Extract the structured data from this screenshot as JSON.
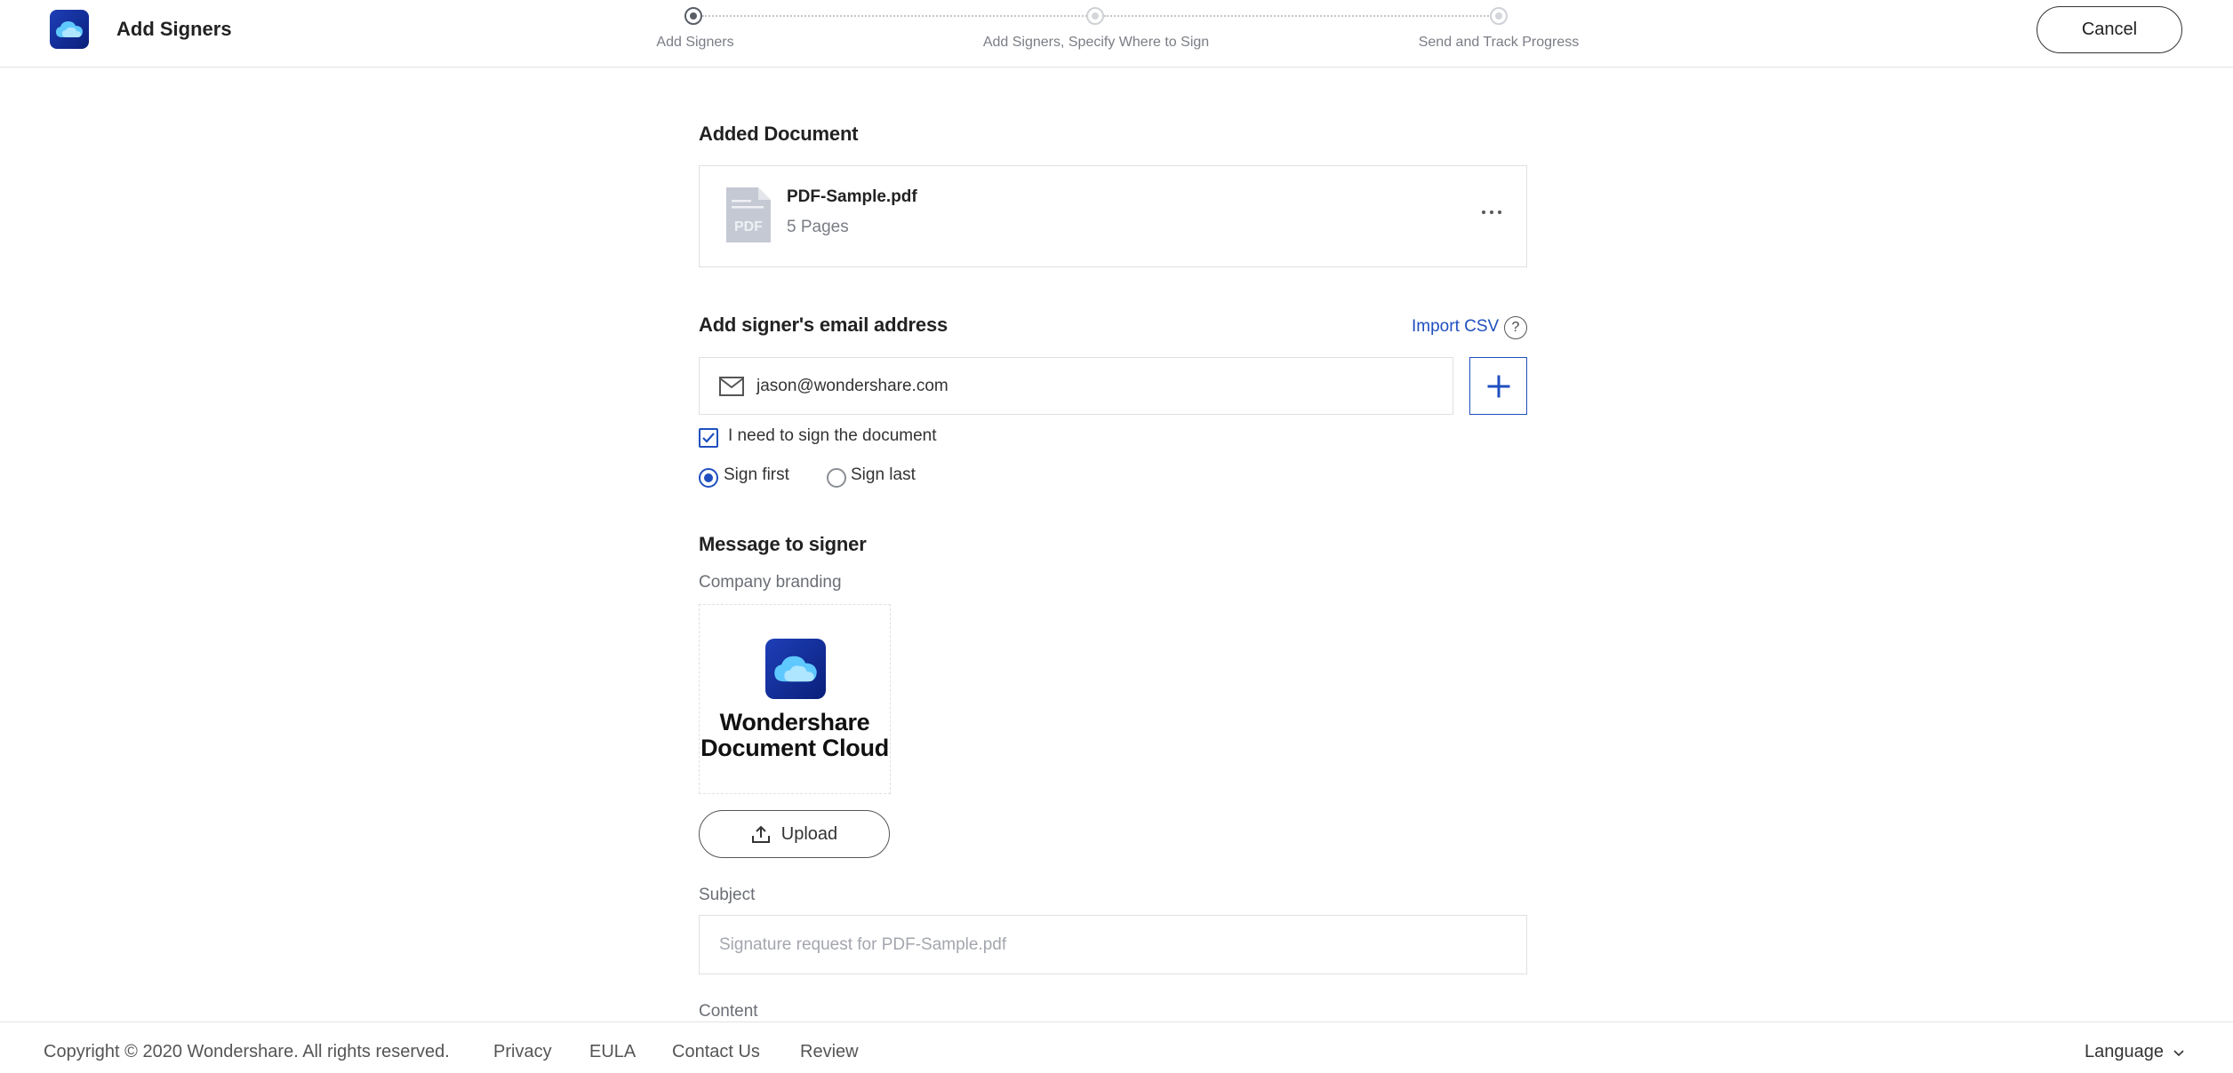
{
  "header": {
    "title": "Add Signers",
    "cancel_label": "Cancel",
    "steps": [
      {
        "label": "Add Signers",
        "active": true
      },
      {
        "label": "Add Signers, Specify Where to Sign",
        "active": false
      },
      {
        "label": "Send and Track Progress",
        "active": false
      }
    ]
  },
  "document": {
    "section_title": "Added Document",
    "name": "PDF-Sample.pdf",
    "pages": "5 Pages",
    "icon_text": "PDF"
  },
  "signer": {
    "section_title": "Add signer's email address",
    "import_csv": "Import CSV",
    "help_icon": "?",
    "email_value": "jason@wondershare.com",
    "self_sign_label": "I need to sign the document",
    "self_sign_checked": true,
    "order_options": [
      "Sign first",
      "Sign last"
    ],
    "order_selected": "Sign first"
  },
  "message": {
    "section_title": "Message to signer",
    "branding_label": "Company branding",
    "brand_name": "Wondershare Document Cloud",
    "upload_label": "Upload",
    "subject_label": "Subject",
    "subject_placeholder": "Signature request for PDF-Sample.pdf",
    "content_label": "Content"
  },
  "footer": {
    "copyright": "Copyright © 2020 Wondershare. All rights reserved.",
    "links": [
      "Privacy",
      "EULA",
      "Contact Us",
      "Review"
    ],
    "language": "Language"
  },
  "colors": {
    "accent": "#1f4fbf",
    "brand_gradient_start": "#1e3fb8",
    "brand_gradient_end": "#0a1f7a"
  },
  "icons": [
    "cloud-logo-icon",
    "pdf-file-icon",
    "more-horizontal-icon",
    "help-icon",
    "mail-icon",
    "plus-icon",
    "upload-icon",
    "chevron-down-icon"
  ]
}
